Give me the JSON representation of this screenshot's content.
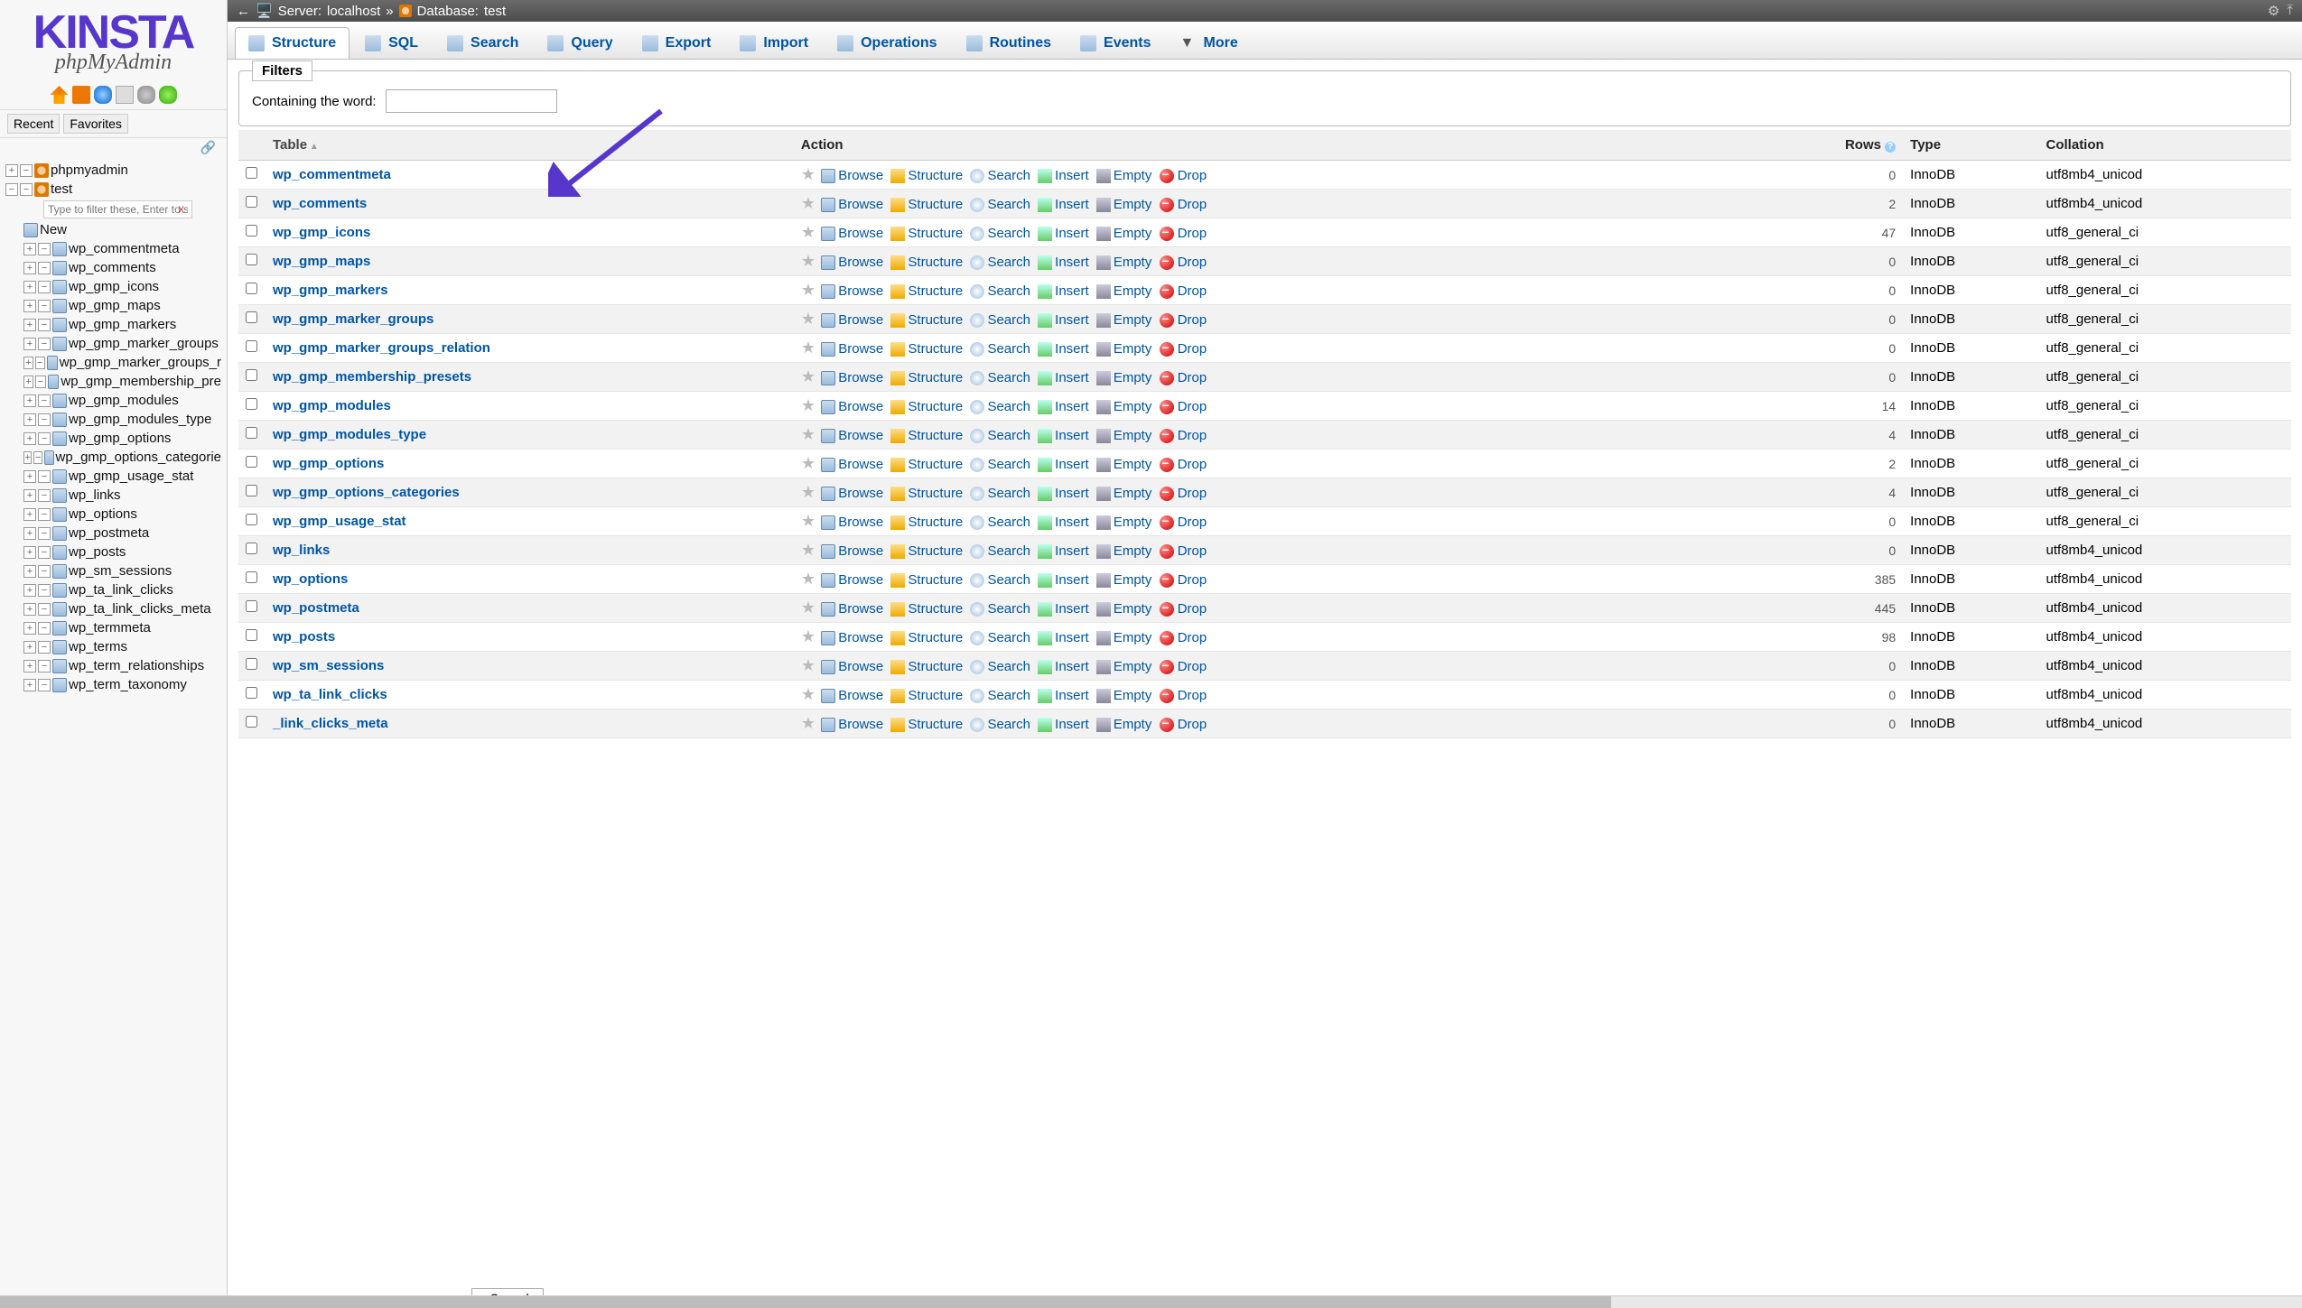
{
  "logo": {
    "brand": "KINSTA",
    "product": "phpMyAdmin"
  },
  "sidebar": {
    "recent": "Recent",
    "favorites": "Favorites",
    "root": "phpmyadmin",
    "db": "test",
    "filter_placeholder": "Type to filter these, Enter to search",
    "new_label": "New",
    "tables": [
      "wp_commentmeta",
      "wp_comments",
      "wp_gmp_icons",
      "wp_gmp_maps",
      "wp_gmp_markers",
      "wp_gmp_marker_groups",
      "wp_gmp_marker_groups_r",
      "wp_gmp_membership_pre",
      "wp_gmp_modules",
      "wp_gmp_modules_type",
      "wp_gmp_options",
      "wp_gmp_options_categorie",
      "wp_gmp_usage_stat",
      "wp_links",
      "wp_options",
      "wp_postmeta",
      "wp_posts",
      "wp_sm_sessions",
      "wp_ta_link_clicks",
      "wp_ta_link_clicks_meta",
      "wp_termmeta",
      "wp_terms",
      "wp_term_relationships",
      "wp_term_taxonomy"
    ]
  },
  "breadcrumb": {
    "server_label": "Server:",
    "server": "localhost",
    "db_label": "Database:",
    "db": "test"
  },
  "tabs": [
    {
      "label": "Structure",
      "icon": "structure-icon",
      "active": true
    },
    {
      "label": "SQL",
      "icon": "sql-icon"
    },
    {
      "label": "Search",
      "icon": "search-icon"
    },
    {
      "label": "Query",
      "icon": "query-icon"
    },
    {
      "label": "Export",
      "icon": "export-icon"
    },
    {
      "label": "Import",
      "icon": "import-icon"
    },
    {
      "label": "Operations",
      "icon": "operations-icon"
    },
    {
      "label": "Routines",
      "icon": "routines-icon"
    },
    {
      "label": "Events",
      "icon": "events-icon"
    },
    {
      "label": "More",
      "icon": "more-icon"
    }
  ],
  "filters": {
    "legend": "Filters",
    "label": "Containing the word:",
    "value": ""
  },
  "columns": {
    "table": "Table",
    "action": "Action",
    "rows": "Rows",
    "type": "Type",
    "collation": "Collation"
  },
  "actions": {
    "browse": "Browse",
    "structure": "Structure",
    "search": "Search",
    "insert": "Insert",
    "empty": "Empty",
    "drop": "Drop"
  },
  "rows": [
    {
      "name": "wp_commentmeta",
      "rows": 0,
      "type": "InnoDB",
      "collation": "utf8mb4_unicod"
    },
    {
      "name": "wp_comments",
      "rows": 2,
      "type": "InnoDB",
      "collation": "utf8mb4_unicod"
    },
    {
      "name": "wp_gmp_icons",
      "rows": 47,
      "type": "InnoDB",
      "collation": "utf8_general_ci"
    },
    {
      "name": "wp_gmp_maps",
      "rows": 0,
      "type": "InnoDB",
      "collation": "utf8_general_ci"
    },
    {
      "name": "wp_gmp_markers",
      "rows": 0,
      "type": "InnoDB",
      "collation": "utf8_general_ci"
    },
    {
      "name": "wp_gmp_marker_groups",
      "rows": 0,
      "type": "InnoDB",
      "collation": "utf8_general_ci"
    },
    {
      "name": "wp_gmp_marker_groups_relation",
      "rows": 0,
      "type": "InnoDB",
      "collation": "utf8_general_ci"
    },
    {
      "name": "wp_gmp_membership_presets",
      "rows": 0,
      "type": "InnoDB",
      "collation": "utf8_general_ci"
    },
    {
      "name": "wp_gmp_modules",
      "rows": 14,
      "type": "InnoDB",
      "collation": "utf8_general_ci"
    },
    {
      "name": "wp_gmp_modules_type",
      "rows": 4,
      "type": "InnoDB",
      "collation": "utf8_general_ci"
    },
    {
      "name": "wp_gmp_options",
      "rows": 2,
      "type": "InnoDB",
      "collation": "utf8_general_ci"
    },
    {
      "name": "wp_gmp_options_categories",
      "rows": 4,
      "type": "InnoDB",
      "collation": "utf8_general_ci"
    },
    {
      "name": "wp_gmp_usage_stat",
      "rows": 0,
      "type": "InnoDB",
      "collation": "utf8_general_ci"
    },
    {
      "name": "wp_links",
      "rows": 0,
      "type": "InnoDB",
      "collation": "utf8mb4_unicod"
    },
    {
      "name": "wp_options",
      "rows": 385,
      "type": "InnoDB",
      "collation": "utf8mb4_unicod"
    },
    {
      "name": "wp_postmeta",
      "rows": 445,
      "type": "InnoDB",
      "collation": "utf8mb4_unicod"
    },
    {
      "name": "wp_posts",
      "rows": 98,
      "type": "InnoDB",
      "collation": "utf8mb4_unicod"
    },
    {
      "name": "wp_sm_sessions",
      "rows": 0,
      "type": "InnoDB",
      "collation": "utf8mb4_unicod"
    },
    {
      "name": "wp_ta_link_clicks",
      "rows": 0,
      "type": "InnoDB",
      "collation": "utf8mb4_unicod"
    },
    {
      "name": "_link_clicks_meta",
      "rows": 0,
      "type": "InnoDB",
      "collation": "utf8mb4_unicod"
    }
  ],
  "console": "Console"
}
